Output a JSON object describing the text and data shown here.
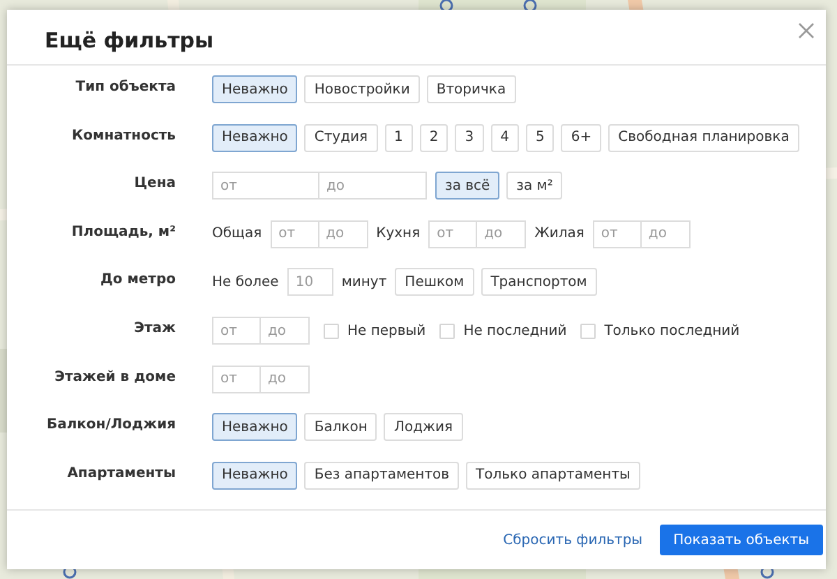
{
  "dialog": {
    "title": "Ещё фильтры"
  },
  "filters": [
    {
      "label": "Тип объекта",
      "parts": [
        {
          "kind": "options",
          "options": [
            {
              "label": "Неважно",
              "selected": true
            },
            {
              "label": "Новостройки",
              "selected": false
            },
            {
              "label": "Вторичка",
              "selected": false
            }
          ]
        }
      ]
    },
    {
      "label": "Комнатность",
      "parts": [
        {
          "kind": "options",
          "options": [
            {
              "label": "Неважно",
              "selected": true
            },
            {
              "label": "Студия",
              "selected": false
            },
            {
              "label": "1",
              "selected": false
            },
            {
              "label": "2",
              "selected": false
            },
            {
              "label": "3",
              "selected": false
            },
            {
              "label": "4",
              "selected": false
            },
            {
              "label": "5",
              "selected": false
            },
            {
              "label": "6+",
              "selected": false
            },
            {
              "label": "Свободная планировка",
              "selected": false
            }
          ]
        }
      ]
    },
    {
      "label": "Цена",
      "parts": [
        {
          "kind": "wide_range",
          "fields": [
            {
              "placeholder": "от"
            },
            {
              "placeholder": "до"
            }
          ]
        },
        {
          "kind": "options",
          "options": [
            {
              "label": "за всё",
              "selected": true
            },
            {
              "label": "за м²",
              "selected": false
            }
          ]
        }
      ]
    },
    {
      "label": "Площадь, м²",
      "parts": [
        {
          "kind": "text",
          "text": "Общая"
        },
        {
          "kind": "range",
          "fields": [
            {
              "placeholder": "от"
            },
            {
              "placeholder": "до"
            }
          ]
        },
        {
          "kind": "text",
          "text": "Кухня"
        },
        {
          "kind": "range",
          "fields": [
            {
              "placeholder": "от"
            },
            {
              "placeholder": "до"
            }
          ]
        },
        {
          "kind": "text",
          "text": "Жилая"
        },
        {
          "kind": "range",
          "fields": [
            {
              "placeholder": "от"
            },
            {
              "placeholder": "до"
            }
          ]
        }
      ]
    },
    {
      "label": "До метро",
      "parts": [
        {
          "kind": "text",
          "text": "Не более"
        },
        {
          "kind": "field",
          "placeholder": "10"
        },
        {
          "kind": "text",
          "text": "минут"
        },
        {
          "kind": "options",
          "options": [
            {
              "label": "Пешком",
              "selected": false
            },
            {
              "label": "Транспортом",
              "selected": false
            }
          ]
        }
      ]
    },
    {
      "label": "Этаж",
      "parts": [
        {
          "kind": "range",
          "fields": [
            {
              "placeholder": "от"
            },
            {
              "placeholder": "до"
            }
          ]
        },
        {
          "kind": "checkbox",
          "label": "Не первый",
          "checked": false
        },
        {
          "kind": "checkbox",
          "label": "Не последний",
          "checked": false
        },
        {
          "kind": "checkbox",
          "label": "Только последний",
          "checked": false
        }
      ]
    },
    {
      "label": "Этажей в доме",
      "parts": [
        {
          "kind": "range",
          "fields": [
            {
              "placeholder": "от"
            },
            {
              "placeholder": "до"
            }
          ]
        }
      ]
    },
    {
      "label": "Балкон/Лоджия",
      "parts": [
        {
          "kind": "options",
          "options": [
            {
              "label": "Неважно",
              "selected": true
            },
            {
              "label": "Балкон",
              "selected": false
            },
            {
              "label": "Лоджия",
              "selected": false
            }
          ]
        }
      ]
    },
    {
      "label": "Апартаменты",
      "parts": [
        {
          "kind": "options",
          "options": [
            {
              "label": "Неважно",
              "selected": true
            },
            {
              "label": "Без апартаментов",
              "selected": false
            },
            {
              "label": "Только апартаменты",
              "selected": false
            }
          ]
        }
      ]
    }
  ],
  "footer": {
    "reset": "Сбросить фильтры",
    "submit": "Показать объекты"
  }
}
